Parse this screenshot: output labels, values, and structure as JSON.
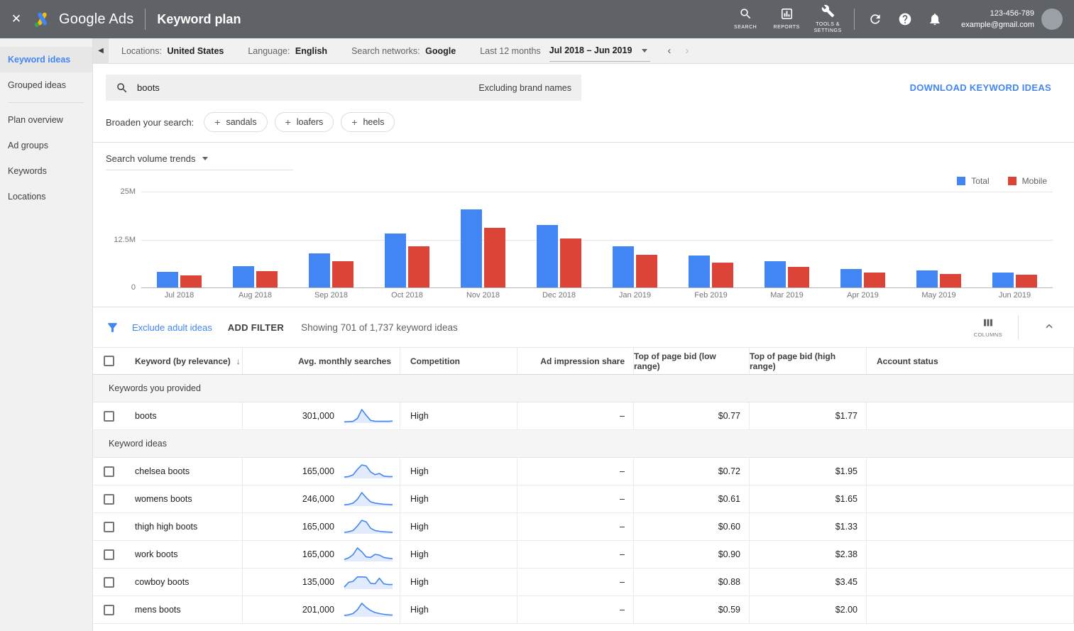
{
  "topbar": {
    "brand": "Google Ads",
    "page_title": "Keyword plan",
    "nav": [
      {
        "icon": "search-icon",
        "label": "SEARCH"
      },
      {
        "icon": "reports-icon",
        "label": "REPORTS"
      },
      {
        "icon": "tools-settings-icon",
        "label": "TOOLS & SETTINGS"
      }
    ],
    "account_id": "123-456-789",
    "account_email": "example@gmail.com"
  },
  "sidebar": {
    "items": [
      {
        "label": "Keyword ideas",
        "active": true
      },
      {
        "label": "Grouped ideas",
        "active": false
      },
      {
        "divider": true
      },
      {
        "label": "Plan overview",
        "active": false
      },
      {
        "label": "Ad groups",
        "active": false
      },
      {
        "label": "Keywords",
        "active": false
      },
      {
        "label": "Locations",
        "active": false
      }
    ]
  },
  "filterbar": {
    "filters": [
      {
        "label": "Locations:",
        "value": "United States"
      },
      {
        "label": "Language:",
        "value": "English"
      },
      {
        "label": "Search networks:",
        "value": "Google"
      }
    ],
    "date_range_label": "Last 12 months",
    "date_range_value": "Jul 2018 – Jun 2019"
  },
  "search": {
    "query": "boots",
    "exclusion_note": "Excluding brand names",
    "download_button": "DOWNLOAD KEYWORD IDEAS"
  },
  "broaden": {
    "label": "Broaden your search:",
    "chips": [
      "sandals",
      "loafers",
      "heels"
    ]
  },
  "chart_data": {
    "type": "bar",
    "title": "Search volume trends",
    "categories": [
      "Jul 2018",
      "Aug 2018",
      "Sep 2018",
      "Oct 2018",
      "Nov 2018",
      "Dec 2018",
      "Jan 2019",
      "Feb 2019",
      "Mar 2019",
      "Apr 2019",
      "May 2019",
      "Jun 2019"
    ],
    "series": [
      {
        "name": "Total",
        "color": "#4285f4",
        "values": [
          4100000,
          5600000,
          8900000,
          14100000,
          20300000,
          16300000,
          10700000,
          8300000,
          6900000,
          4900000,
          4500000,
          3900000
        ]
      },
      {
        "name": "Mobile",
        "color": "#db4437",
        "values": [
          3100000,
          4200000,
          6800000,
          10800000,
          15600000,
          12700000,
          8500000,
          6500000,
          5400000,
          3800000,
          3600000,
          3400000
        ]
      }
    ],
    "xlabel": "",
    "ylabel": "",
    "ylim": [
      0,
      25000000
    ],
    "yticks": [
      {
        "value": 25000000,
        "label": "25M"
      },
      {
        "value": 12500000,
        "label": "12.5M"
      },
      {
        "value": 0,
        "label": "0"
      }
    ],
    "grid": true,
    "legend_position": "top-right"
  },
  "results_toolbar": {
    "exclude_adult_label": "Exclude adult ideas",
    "add_filter_label": "ADD FILTER",
    "showing_text": "Showing 701 of 1,737 keyword ideas",
    "columns_label": "COLUMNS"
  },
  "table": {
    "columns": [
      "Keyword (by relevance)",
      "Avg. monthly searches",
      "Competition",
      "Ad impression share",
      "Top of page bid (low range)",
      "Top of page bid (high range)",
      "Account status"
    ],
    "sections": [
      {
        "title": "Keywords you provided",
        "rows": [
          {
            "keyword": "boots",
            "avg_monthly_searches": "301,000",
            "competition": "High",
            "ad_impression_share": "–",
            "bid_low": "$0.77",
            "bid_high": "$1.77",
            "account_status": "",
            "sparkline": [
              4,
              5,
              8,
              30,
              100,
              55,
              15,
              9,
              8,
              8,
              8,
              10
            ]
          }
        ]
      },
      {
        "title": "Keyword ideas",
        "rows": [
          {
            "keyword": "chelsea boots",
            "avg_monthly_searches": "165,000",
            "competition": "High",
            "ad_impression_share": "–",
            "bid_low": "$0.72",
            "bid_high": "$1.95",
            "account_status": "",
            "sparkline": [
              5,
              9,
              22,
              65,
              100,
              92,
              45,
              24,
              33,
              12,
              9,
              9
            ]
          },
          {
            "keyword": "womens boots",
            "avg_monthly_searches": "246,000",
            "competition": "High",
            "ad_impression_share": "–",
            "bid_low": "$0.61",
            "bid_high": "$1.65",
            "account_status": "",
            "sparkline": [
              4,
              8,
              18,
              48,
              100,
              60,
              28,
              18,
              13,
              9,
              7,
              5
            ]
          },
          {
            "keyword": "thigh high boots",
            "avg_monthly_searches": "165,000",
            "competition": "High",
            "ad_impression_share": "–",
            "bid_low": "$0.60",
            "bid_high": "$1.33",
            "account_status": "",
            "sparkline": [
              5,
              10,
              20,
              55,
              100,
              88,
              38,
              20,
              14,
              10,
              8,
              6
            ]
          },
          {
            "keyword": "work boots",
            "avg_monthly_searches": "165,000",
            "competition": "High",
            "ad_impression_share": "–",
            "bid_low": "$0.90",
            "bid_high": "$2.38",
            "account_status": "",
            "sparkline": [
              10,
              22,
              48,
              100,
              70,
              30,
              26,
              50,
              44,
              26,
              20,
              16
            ]
          },
          {
            "keyword": "cowboy boots",
            "avg_monthly_searches": "135,000",
            "competition": "High",
            "ad_impression_share": "–",
            "bid_low": "$0.88",
            "bid_high": "$3.45",
            "account_status": "",
            "sparkline": [
              10,
              48,
              55,
              90,
              90,
              88,
              40,
              36,
              80,
              36,
              30,
              30
            ]
          },
          {
            "keyword": "mens boots",
            "avg_monthly_searches": "201,000",
            "competition": "High",
            "ad_impression_share": "–",
            "bid_low": "$0.59",
            "bid_high": "$2.00",
            "account_status": "",
            "sparkline": [
              5,
              10,
              20,
              50,
              100,
              68,
              44,
              28,
              20,
              14,
              10,
              8
            ]
          }
        ]
      }
    ]
  }
}
